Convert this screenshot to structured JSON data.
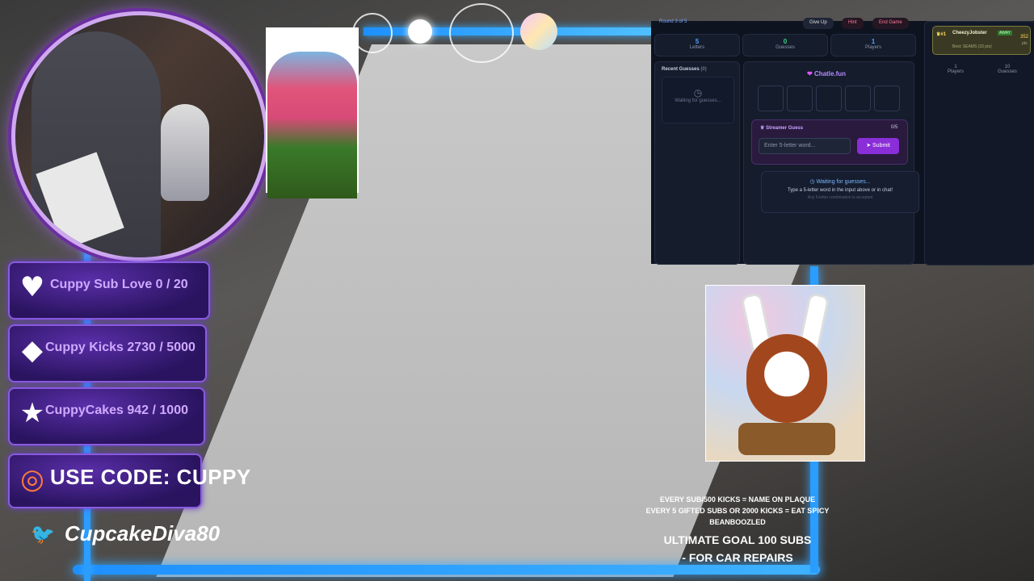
{
  "overlay": {
    "goals": [
      {
        "label": "Cuppy Sub Love 0 / 20",
        "icon": "heart-icon"
      },
      {
        "label": "Cuppy Kicks 2730 / 5000",
        "icon": "diamond-icon"
      },
      {
        "label": "CuppyCakes 942 / 1000",
        "icon": "star-icon"
      }
    ],
    "code_label": "USE CODE: CUPPY",
    "twitter_handle": "CupcakeDiva80",
    "rules": {
      "line1": "EVERY SUB/500 KICKS = NAME ON PLAQUE",
      "line2": "EVERY 5 GIFTED SUBS OR 2000 KICKS = EAT SPICY BEANBOOZLED",
      "line3": "ULTIMATE GOAL 100 SUBS",
      "line4": "- FOR CAR REPAIRS"
    }
  },
  "game": {
    "round_label": "Round 3 of 5",
    "give_up_label": "Give Up",
    "hint_label": "Hint",
    "end_game_label": "End Game",
    "stats": [
      {
        "value": "5",
        "label": "Letters"
      },
      {
        "value": "0",
        "label": "Guesses"
      },
      {
        "value": "1",
        "label": "Players"
      }
    ],
    "recent_guesses_label": "Recent Guesses",
    "recent_guesses_count": "(0)",
    "waiting_small": "Waiting for guesses...",
    "brand": "Chatle.fun",
    "streamer_guess_label": "Streamer Guess",
    "streamer_guess_count": "0/5",
    "input_placeholder": "Enter 5-letter word...",
    "submit_label": "Submit",
    "waiting_title": "Waiting for guesses...",
    "waiting_desc": "Type a 5-letter word in the input above or in chat!",
    "waiting_note": "Any 5-letter combination is accepted",
    "leaderboard": {
      "rank": "#1",
      "name": "CheezyJobster",
      "badge": "AWAY",
      "points": "352",
      "points_unit": "pts",
      "detail": "Best: SEAMS (33 pts)",
      "players_value": "1",
      "players_label": "Players",
      "guesses_value": "10",
      "guesses_label": "Guesses"
    }
  },
  "colors": {
    "accent_blue": "#2a9dff",
    "goal_purple": "#5a2ea8",
    "game_bg": "#0e1320",
    "submit_purple": "#8a2ed8"
  }
}
